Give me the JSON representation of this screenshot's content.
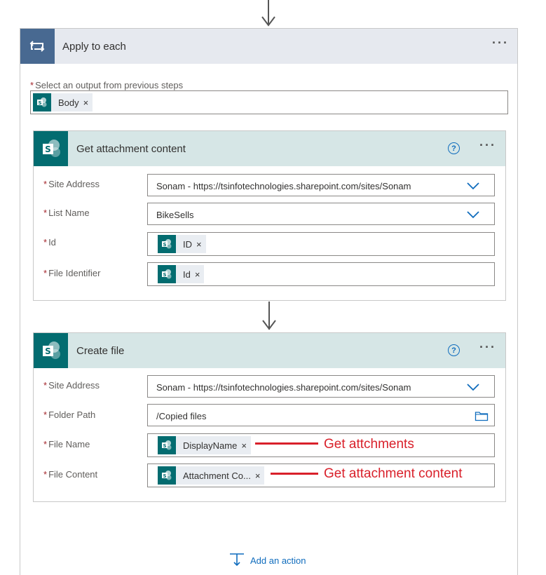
{
  "apply_to_each": {
    "title": "Apply to each",
    "select_output_label": "Select an output from previous steps",
    "required_marker": "*",
    "token": "Body",
    "token_remove": "×"
  },
  "get_attachment_content": {
    "title": "Get attachment content",
    "help": "?",
    "fields": {
      "site_address": {
        "label": "Site Address",
        "value": "Sonam - https://tsinfotechnologies.sharepoint.com/sites/Sonam"
      },
      "list_name": {
        "label": "List Name",
        "value": "BikeSells"
      },
      "id": {
        "label": "Id",
        "token": "ID"
      },
      "file_identifier": {
        "label": "File Identifier",
        "token": "Id"
      }
    }
  },
  "create_file": {
    "title": "Create file",
    "help": "?",
    "fields": {
      "site_address": {
        "label": "Site Address",
        "value": "Sonam - https://tsinfotechnologies.sharepoint.com/sites/Sonam"
      },
      "folder_path": {
        "label": "Folder Path",
        "value": "/Copied files"
      },
      "file_name": {
        "label": "File Name",
        "token": "DisplayName"
      },
      "file_content": {
        "label": "File Content",
        "token": "Attachment Co..."
      }
    }
  },
  "annotations": {
    "file_name_note": "Get attchments",
    "file_content_note": "Get attachment content"
  },
  "footer": {
    "add_action": "Add an action"
  },
  "colors": {
    "loop_header": "#486991",
    "sharepoint": "#036c70",
    "card_header": "#d6e6e6",
    "annotation": "#d9202a",
    "link": "#0f6cbd"
  },
  "icons": {
    "loop": "loop-icon",
    "sharepoint": "sharepoint-icon",
    "chevron": "chevron-down-icon",
    "folder": "folder-icon",
    "help": "help-icon",
    "more": "more-icon",
    "add": "add-action-icon"
  }
}
